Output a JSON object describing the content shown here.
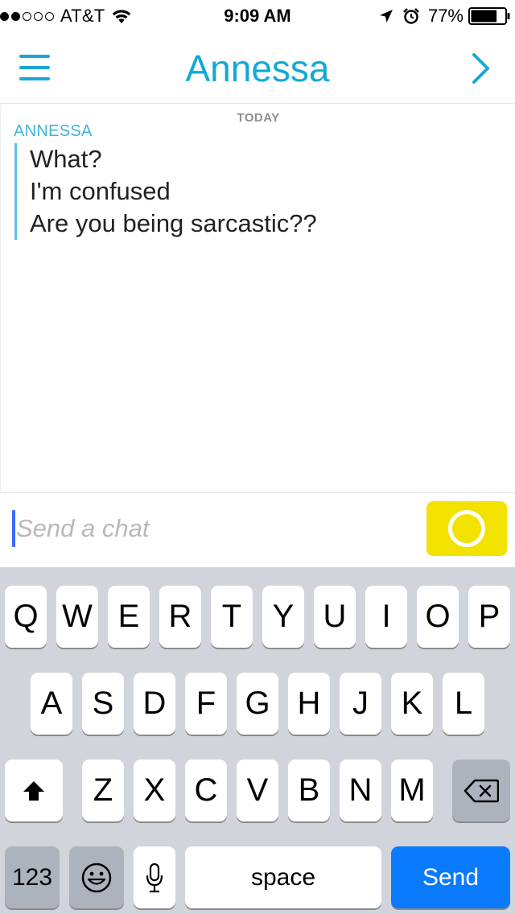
{
  "status_bar": {
    "carrier": "AT&T",
    "signal_strength": 2,
    "signal_max": 5,
    "time": "9:09 AM",
    "battery_percent": "77%",
    "battery_level": 0.77,
    "icons": [
      "wifi-icon",
      "location-arrow-icon",
      "alarm-clock-icon",
      "battery-icon"
    ]
  },
  "header": {
    "title": "Annessa",
    "left_icon": "menu-icon",
    "right_icon": "chevron-right-icon",
    "accent_color": "#12a9d4"
  },
  "chat": {
    "day_label": "TODAY",
    "sender": "ANNESSA",
    "messages": [
      "What?",
      "I'm confused",
      "Are you being sarcastic??"
    ]
  },
  "input": {
    "placeholder": "Send a chat",
    "value": "",
    "capture_icon": "camera-capture-icon",
    "capture_color": "#f3e100"
  },
  "keyboard": {
    "row1": [
      "Q",
      "W",
      "E",
      "R",
      "T",
      "Y",
      "U",
      "I",
      "O",
      "P"
    ],
    "row2": [
      "A",
      "S",
      "D",
      "F",
      "G",
      "H",
      "J",
      "K",
      "L"
    ],
    "row3": [
      "Z",
      "X",
      "C",
      "V",
      "B",
      "N",
      "M"
    ],
    "shift_icon": "shift-icon",
    "delete_icon": "backspace-icon",
    "numbers_label": "123",
    "emoji_icon": "emoji-icon",
    "mic_icon": "microphone-icon",
    "space_label": "space",
    "send_label": "Send",
    "send_color": "#0a7aff"
  }
}
